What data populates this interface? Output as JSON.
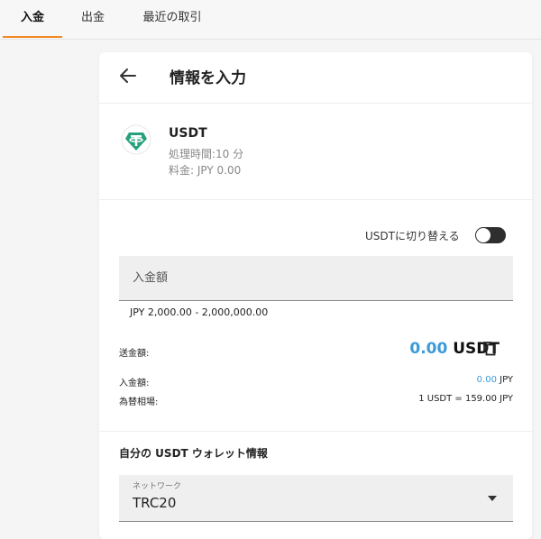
{
  "tabs": [
    {
      "label": "入金",
      "active": true
    },
    {
      "label": "出金",
      "active": false
    },
    {
      "label": "最近の取引",
      "active": false
    }
  ],
  "accent_color": "#f08a24",
  "header": {
    "title": "情報を入力",
    "back_icon": "arrow-left-icon"
  },
  "coin": {
    "name": "USDT",
    "processing_time": "処理時間:10 分",
    "fee": "料金: JPY 0.00",
    "logo_icon": "tether-icon",
    "logo_color": "#26a17b"
  },
  "toggle": {
    "label": "USDTに切り替える",
    "on": false
  },
  "amount": {
    "placeholder": "入金額",
    "range": "JPY 2,000.00 - 2,000,000.00"
  },
  "send": {
    "label": "送金額:",
    "value": "0.00",
    "currency": "USDT",
    "value_color": "#3b9ad9"
  },
  "deposit": {
    "label": "入金額:",
    "value": "0.00",
    "currency": "JPY"
  },
  "rate": {
    "label": "為替相場:",
    "value": "1 USDT = 159.00 JPY"
  },
  "wallet": {
    "title": "自分の USDT ウォレット情報"
  },
  "network": {
    "label": "ネットワーク",
    "value": "TRC20"
  }
}
